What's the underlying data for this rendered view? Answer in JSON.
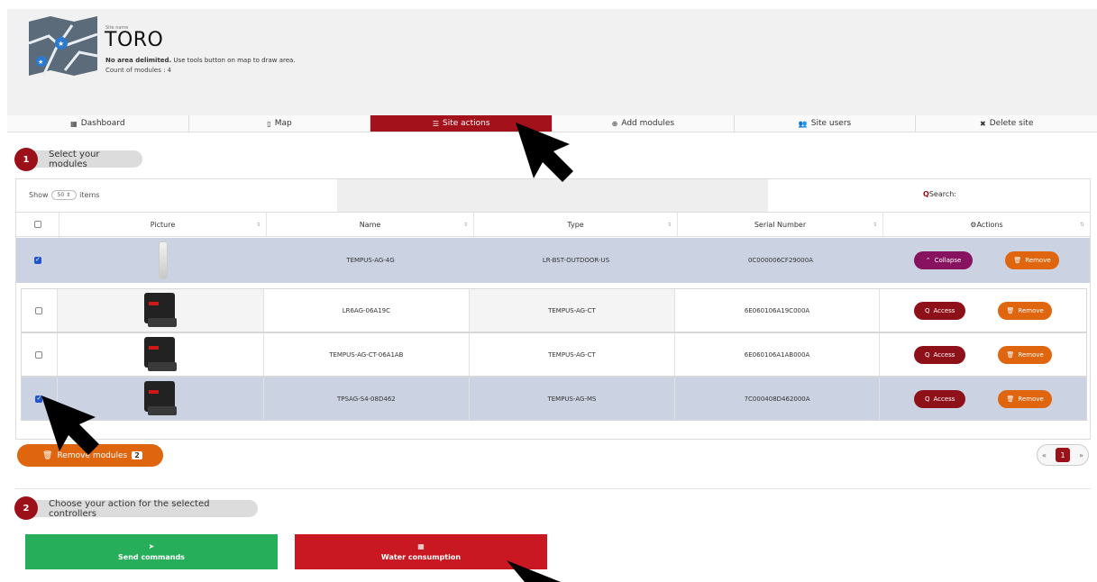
{
  "header": {
    "site_label": "Site name",
    "site_name": "TORO",
    "note_bold": "No area delimited.",
    "note_rest": " Use tools button on map to draw area.",
    "count": "Count of modules : 4"
  },
  "tabs": [
    {
      "label": "Dashboard",
      "icon": "grid-icon"
    },
    {
      "label": "Map",
      "icon": "map-icon"
    },
    {
      "label": "Site actions",
      "icon": "sliders-icon",
      "active": true
    },
    {
      "label": "Add modules",
      "icon": "plus-circle-icon"
    },
    {
      "label": "Site users",
      "icon": "users-icon"
    },
    {
      "label": "Delete site",
      "icon": "close-icon"
    }
  ],
  "step1": {
    "number": "1",
    "label": "Select your modules"
  },
  "step2": {
    "number": "2",
    "label": "Choose your action for the selected controllers"
  },
  "table": {
    "show_label": "Show",
    "page_size": "50",
    "items_label": "items",
    "search_label": "Search:",
    "columns": [
      "Picture",
      "Name",
      "Type",
      "Serial Number",
      "Actions"
    ],
    "rows": [
      {
        "name": "TEMPUS-AG-4G",
        "type": "LR-BST-OUTDOOR-US",
        "serial": "0C000006CF29000A",
        "checked": true,
        "primary": "Collapse",
        "secondary": "Remove"
      },
      {
        "name": "LR6AG-06A19C",
        "type": "TEMPUS-AG-CT",
        "serial": "6E060106A19C000A",
        "checked": false,
        "primary": "Access",
        "secondary": "Remove"
      },
      {
        "name": "TEMPUS-AG-CT-06A1AB",
        "type": "TEMPUS-AG-CT",
        "serial": "6E060106A1AB000A",
        "checked": false,
        "primary": "Access",
        "secondary": "Remove"
      },
      {
        "name": "TPSAG-S4-08D462",
        "type": "TEMPUS-AG-MS",
        "serial": "7C000408D462000A",
        "checked": true,
        "primary": "Access",
        "secondary": "Remove"
      }
    ],
    "remove_modules_label": "Remove modules",
    "remove_modules_count": "2",
    "pagination": {
      "prev": "«",
      "current": "1",
      "next": "»"
    }
  },
  "actions": {
    "send": "Send commands",
    "water": "Water consumption"
  },
  "colors": {
    "brand_red": "#a3111a",
    "orange": "#e0650f",
    "purple": "#87125f",
    "green": "#27ae5a",
    "selected_row": "#cbd3e2"
  }
}
